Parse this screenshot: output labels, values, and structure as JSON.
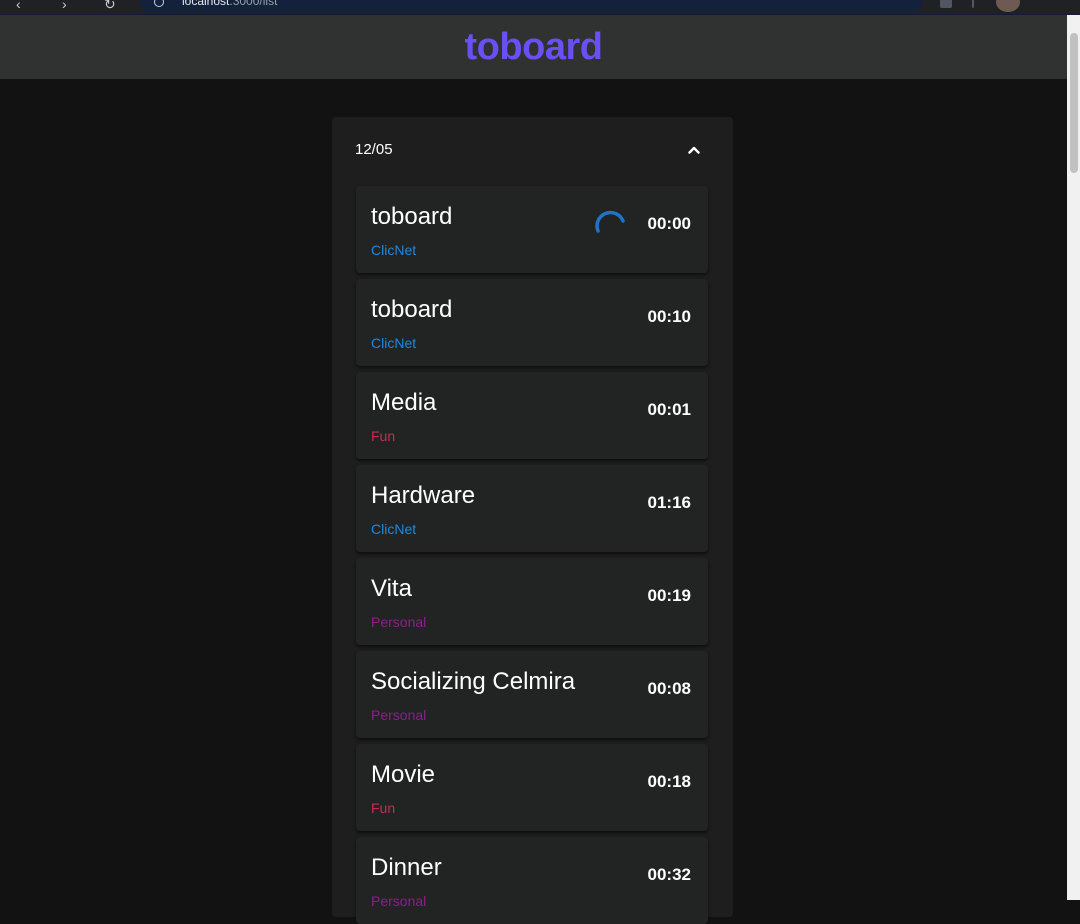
{
  "app": {
    "title": "toboard",
    "title_color": "#6a4ff5"
  },
  "browser": {
    "url_host": "localhost",
    "url_path": ":3000/list"
  },
  "group": {
    "date": "12/05",
    "collapse_icon": "chevron-up-icon"
  },
  "tag_colors": {
    "ClicNet": "#1e88e5",
    "Fun": "#c62d52",
    "Personal": "#8e1e8e"
  },
  "entries": [
    {
      "title": "toboard",
      "tag": "ClicNet",
      "time": "00:00",
      "running": true
    },
    {
      "title": "toboard",
      "tag": "ClicNet",
      "time": "00:10",
      "running": false
    },
    {
      "title": "Media",
      "tag": "Fun",
      "time": "00:01",
      "running": false
    },
    {
      "title": "Hardware",
      "tag": "ClicNet",
      "time": "01:16",
      "running": false
    },
    {
      "title": "Vita",
      "tag": "Personal",
      "time": "00:19",
      "running": false
    },
    {
      "title": "Socializing Celmira",
      "tag": "Personal",
      "time": "00:08",
      "running": false
    },
    {
      "title": "Movie",
      "tag": "Fun",
      "time": "00:18",
      "running": false
    },
    {
      "title": "Dinner",
      "tag": "Personal",
      "time": "00:32",
      "running": false
    }
  ]
}
